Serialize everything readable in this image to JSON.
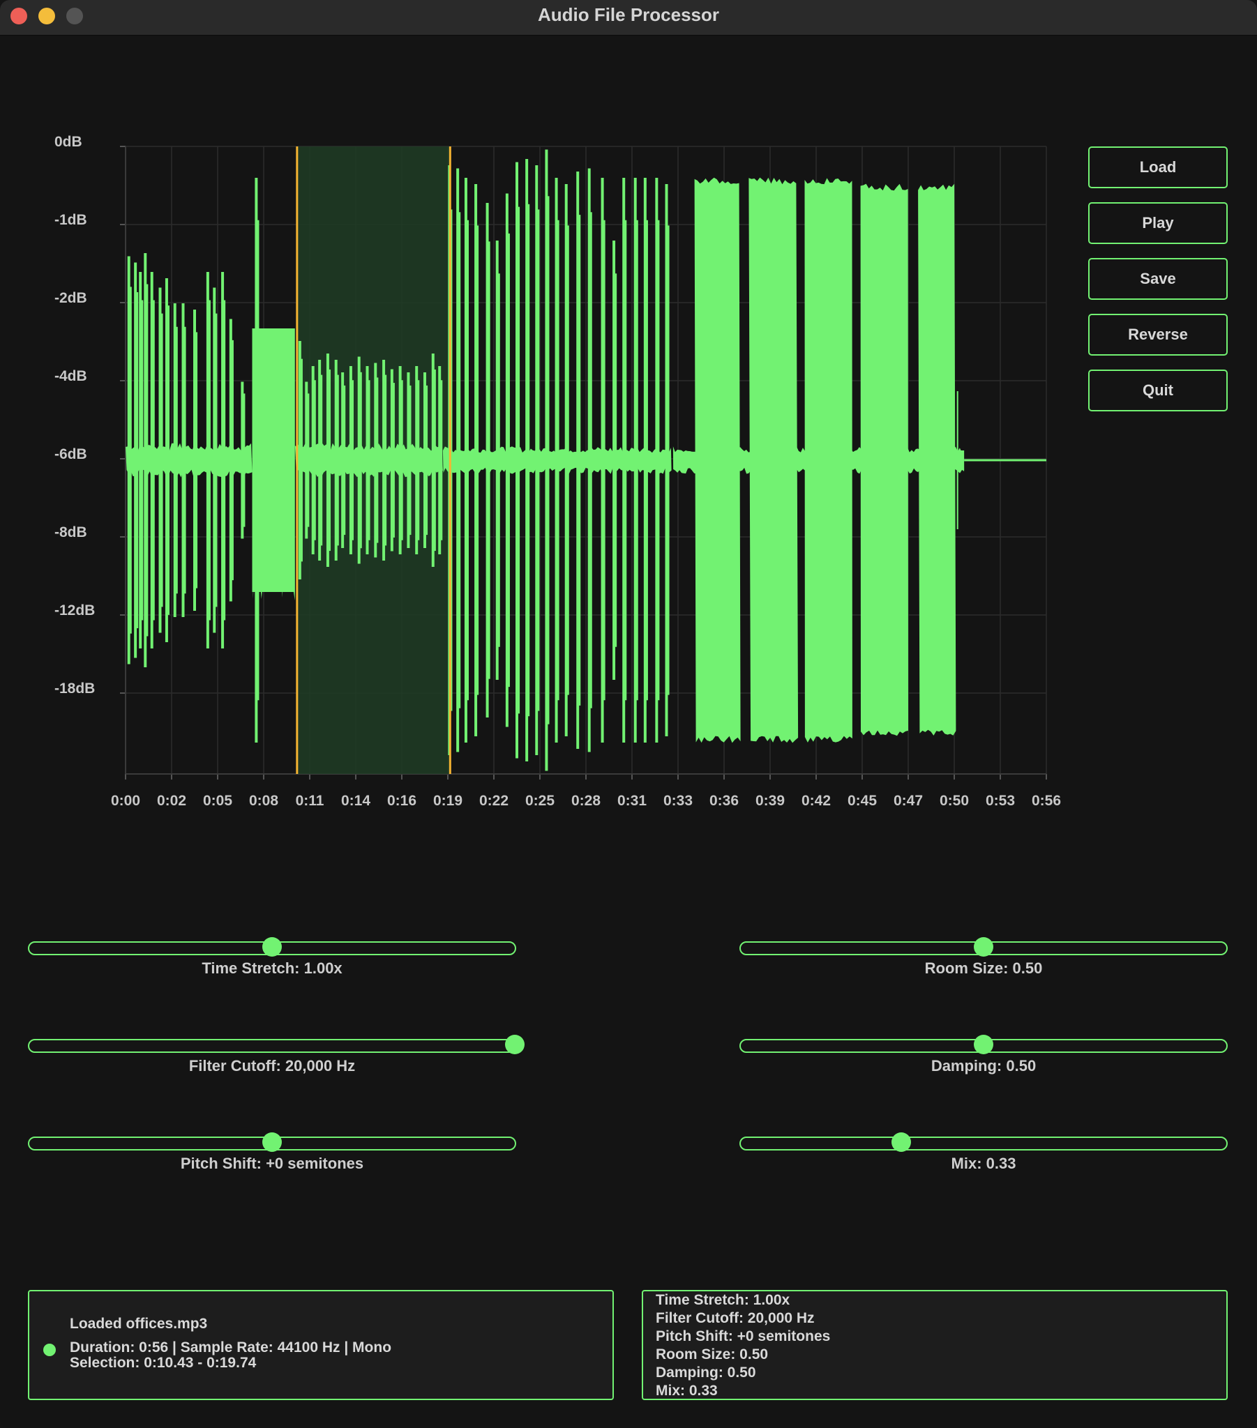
{
  "window": {
    "title": "Audio File Processor"
  },
  "buttons": [
    "Load",
    "Play",
    "Save",
    "Reverse",
    "Quit"
  ],
  "colors": {
    "accent": "#72f272",
    "selection_marker": "#f5b432",
    "selection_fill": "#1f3c24",
    "background": "#141414"
  },
  "chart_data": {
    "type": "area",
    "y_tick_labels": [
      "0dB",
      "-1dB",
      "-2dB",
      "-4dB",
      "-6dB",
      "-8dB",
      "-12dB",
      "-18dB"
    ],
    "x_tick_labels": [
      "0:00",
      "0:02",
      "0:05",
      "0:08",
      "0:11",
      "0:14",
      "0:16",
      "0:19",
      "0:22",
      "0:25",
      "0:28",
      "0:31",
      "0:33",
      "0:36",
      "0:39",
      "0:42",
      "0:45",
      "0:47",
      "0:50",
      "0:53",
      "0:56"
    ],
    "duration_seconds": 56,
    "selection_seconds": [
      10.43,
      19.74
    ],
    "grid": true,
    "segments": [
      {
        "start": 0.0,
        "end": 7.7,
        "peak": 0.05,
        "bursts": [
          {
            "t": 0.2,
            "h": 0.65
          },
          {
            "t": 0.6,
            "h": 0.63
          },
          {
            "t": 0.9,
            "h": 0.6
          },
          {
            "t": 1.2,
            "h": 0.66
          },
          {
            "t": 1.6,
            "h": 0.6
          },
          {
            "t": 2.1,
            "h": 0.55
          },
          {
            "t": 2.5,
            "h": 0.58
          },
          {
            "t": 3.0,
            "h": 0.5
          },
          {
            "t": 3.5,
            "h": 0.5
          },
          {
            "t": 4.2,
            "h": 0.48
          },
          {
            "t": 5.0,
            "h": 0.6
          },
          {
            "t": 5.4,
            "h": 0.55
          },
          {
            "t": 5.9,
            "h": 0.6
          },
          {
            "t": 6.4,
            "h": 0.45
          },
          {
            "t": 7.1,
            "h": 0.25
          }
        ]
      },
      {
        "start": 7.7,
        "end": 10.3,
        "peak": 0.42,
        "bursts": [
          {
            "t": 7.95,
            "h": 0.9
          }
        ]
      },
      {
        "start": 10.3,
        "end": 19.3,
        "peak": 0.05,
        "bursts": [
          {
            "t": 10.6,
            "h": 0.38
          },
          {
            "t": 11.0,
            "h": 0.25
          },
          {
            "t": 11.4,
            "h": 0.3
          },
          {
            "t": 11.8,
            "h": 0.32
          },
          {
            "t": 12.3,
            "h": 0.34
          },
          {
            "t": 12.8,
            "h": 0.32
          },
          {
            "t": 13.2,
            "h": 0.28
          },
          {
            "t": 13.7,
            "h": 0.3
          },
          {
            "t": 14.2,
            "h": 0.33
          },
          {
            "t": 14.7,
            "h": 0.3
          },
          {
            "t": 15.2,
            "h": 0.31
          },
          {
            "t": 15.7,
            "h": 0.32
          },
          {
            "t": 16.2,
            "h": 0.29
          },
          {
            "t": 16.7,
            "h": 0.3
          },
          {
            "t": 17.2,
            "h": 0.28
          },
          {
            "t": 17.7,
            "h": 0.3
          },
          {
            "t": 18.2,
            "h": 0.28
          },
          {
            "t": 18.7,
            "h": 0.34
          },
          {
            "t": 19.1,
            "h": 0.3
          }
        ]
      },
      {
        "start": 19.3,
        "end": 33.2,
        "peak": 0.04,
        "bursts": [
          {
            "t": 19.7,
            "h": 0.94
          },
          {
            "t": 20.2,
            "h": 0.93
          },
          {
            "t": 20.7,
            "h": 0.9
          },
          {
            "t": 21.3,
            "h": 0.88
          },
          {
            "t": 22.0,
            "h": 0.82
          },
          {
            "t": 22.6,
            "h": 0.7
          },
          {
            "t": 23.2,
            "h": 0.85
          },
          {
            "t": 23.8,
            "h": 0.95
          },
          {
            "t": 24.4,
            "h": 0.96
          },
          {
            "t": 25.0,
            "h": 0.94
          },
          {
            "t": 25.6,
            "h": 0.99
          },
          {
            "t": 26.2,
            "h": 0.9
          },
          {
            "t": 26.8,
            "h": 0.88
          },
          {
            "t": 27.5,
            "h": 0.92
          },
          {
            "t": 28.2,
            "h": 0.93
          },
          {
            "t": 29.0,
            "h": 0.9
          },
          {
            "t": 29.7,
            "h": 0.7
          },
          {
            "t": 30.3,
            "h": 0.9
          },
          {
            "t": 31.0,
            "h": 0.9
          },
          {
            "t": 31.6,
            "h": 0.9
          },
          {
            "t": 32.3,
            "h": 0.9
          },
          {
            "t": 32.9,
            "h": 0.88
          }
        ]
      },
      {
        "start": 33.3,
        "end": 51.0,
        "peak": 0.04,
        "blocks": [
          [
            34.6,
            37.4,
            0.89
          ],
          [
            37.9,
            40.9,
            0.89
          ],
          [
            41.3,
            44.2,
            0.89
          ],
          [
            44.7,
            47.6,
            0.87
          ],
          [
            48.2,
            50.5,
            0.87
          ]
        ]
      }
    ]
  },
  "sliders": [
    {
      "label": "Time Stretch: 1.00x",
      "value": 0.5
    },
    {
      "label": "Filter Cutoff: 20,000 Hz",
      "value": 1.0
    },
    {
      "label": "Pitch Shift: +0 semitones",
      "value": 0.5
    },
    {
      "label": "Room Size: 0.50",
      "value": 0.5
    },
    {
      "label": "Damping: 0.50",
      "value": 0.5
    },
    {
      "label": "Mix: 0.33",
      "value": 0.33
    }
  ],
  "status": {
    "loaded": "Loaded offices.mp3",
    "info": "Duration: 0:56 | Sample Rate: 44100 Hz | Mono",
    "selection": "Selection: 0:10.43 - 0:19.74"
  },
  "params_summary": [
    "Time Stretch: 1.00x",
    "Filter Cutoff: 20,000 Hz",
    "Pitch Shift: +0 semitones",
    "Room Size: 0.50",
    "Damping: 0.50",
    "Mix: 0.33"
  ]
}
